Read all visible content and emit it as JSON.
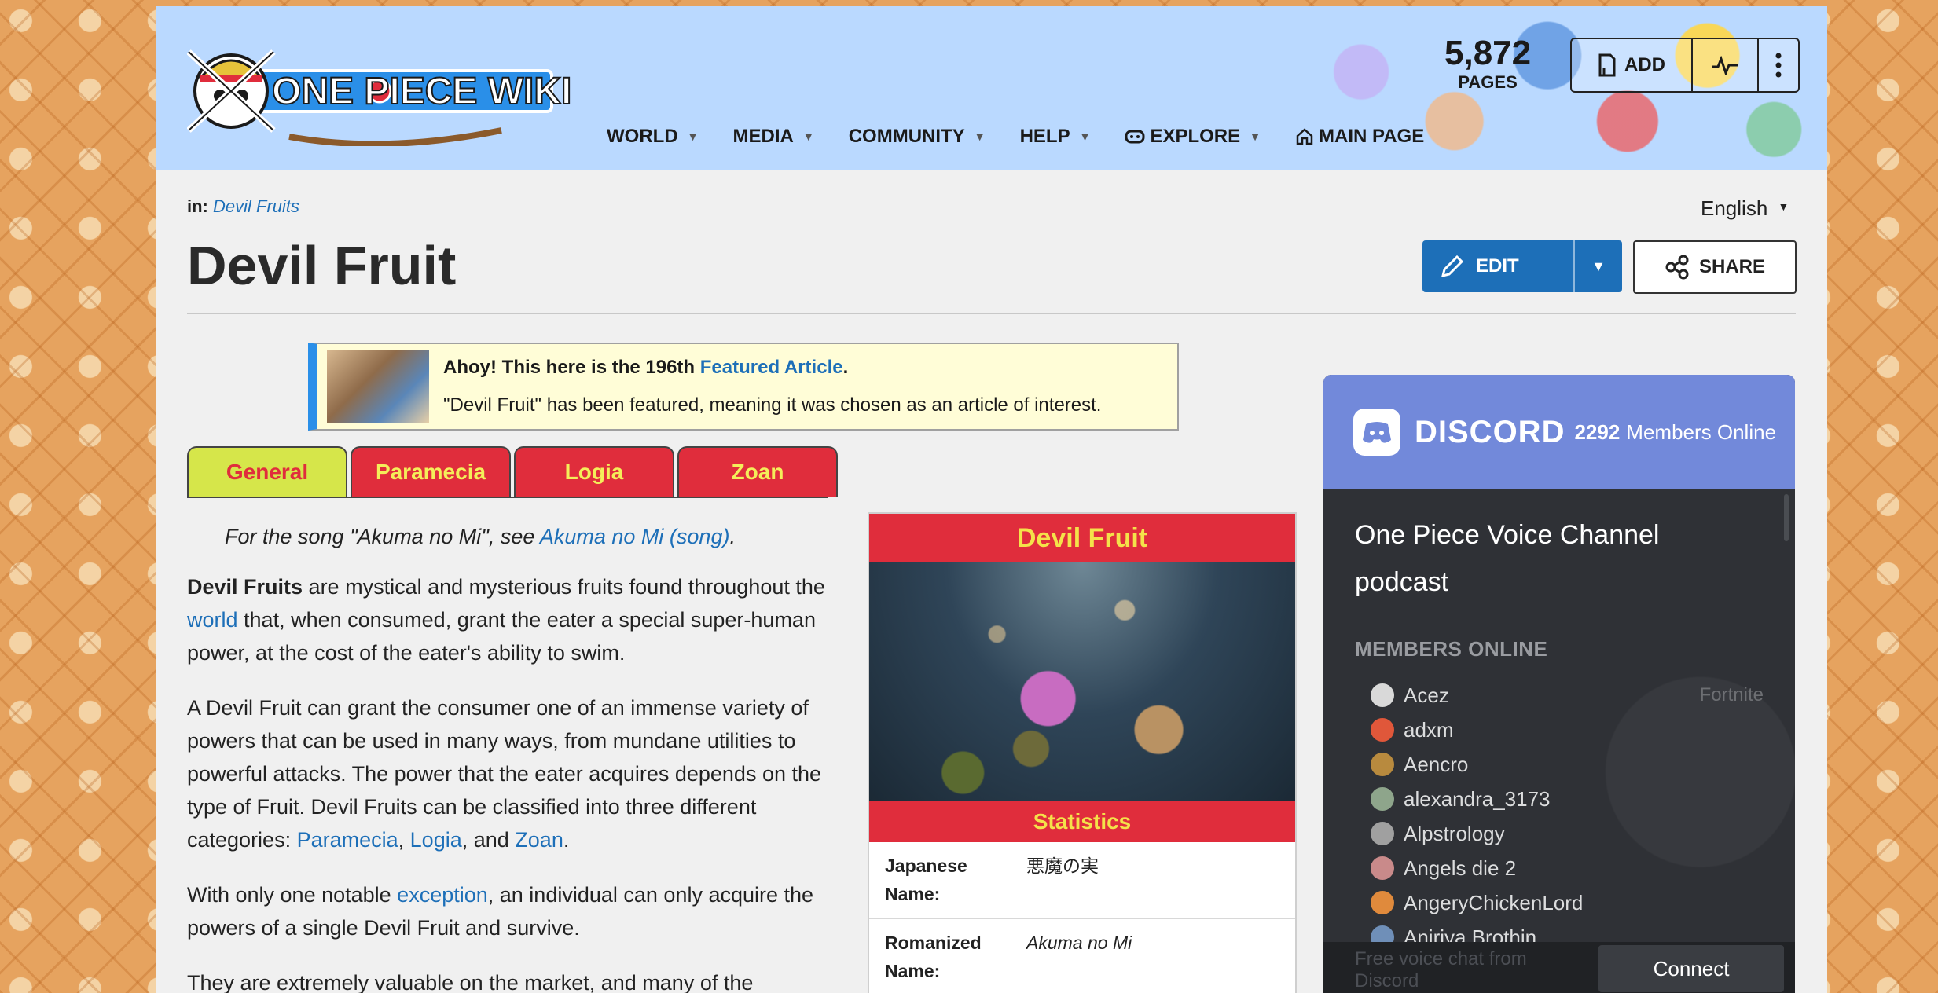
{
  "header": {
    "logo_text": "ONE PIECE WIKI",
    "page_count": "5,872",
    "page_count_label": "PAGES",
    "add_label": "ADD",
    "nav": [
      {
        "label": "WORLD"
      },
      {
        "label": "MEDIA"
      },
      {
        "label": "COMMUNITY"
      },
      {
        "label": "HELP"
      },
      {
        "label": "EXPLORE"
      },
      {
        "label": "MAIN PAGE"
      }
    ]
  },
  "breadcrumb": {
    "prefix": "in:",
    "link": "Devil Fruits"
  },
  "language": "English",
  "article": {
    "title": "Devil Fruit",
    "edit_label": "EDIT",
    "share_label": "SHARE"
  },
  "featured": {
    "line1_prefix": "Ahoy! This here is the 196th ",
    "line1_link": "Featured Article",
    "line1_suffix": ".",
    "line2": "\"Devil Fruit\" has been featured, meaning it was chosen as an article of interest."
  },
  "tabs": [
    {
      "label": "General",
      "active": true
    },
    {
      "label": "Paramecia",
      "active": false
    },
    {
      "label": "Logia",
      "active": false
    },
    {
      "label": "Zoan",
      "active": false
    }
  ],
  "content": {
    "hatnote_prefix": "For the song \"Akuma no Mi\", see ",
    "hatnote_link": "Akuma no Mi (song)",
    "hatnote_suffix": ".",
    "p1_bold": "Devil Fruits",
    "p1_a": " are mystical and mysterious fruits found throughout the ",
    "p1_link": "world",
    "p1_b": " that, when consumed, grant the eater a special super-human power, at the cost of the eater's ability to swim.",
    "p2_a": "A Devil Fruit can grant the consumer one of an immense variety of powers that can be used in many ways, from mundane utilities to powerful attacks. The power that the eater acquires depends on the type of Fruit. Devil Fruits can be classified into three different categories: ",
    "p2_link1": "Paramecia",
    "p2_sep1": ", ",
    "p2_link2": "Logia",
    "p2_sep2": ", and ",
    "p2_link3": "Zoan",
    "p2_end": ".",
    "p3_a": "With only one notable ",
    "p3_link": "exception",
    "p3_b": ", an individual can only acquire the powers of a single Devil Fruit and survive.",
    "p4": "They are extremely valuable on the market, and many of the"
  },
  "infobox": {
    "title": "Devil Fruit",
    "section": "Statistics",
    "rows": [
      {
        "key": "Japanese Name:",
        "value": "悪魔の実"
      },
      {
        "key": "Romanized Name:",
        "value": "Akuma no Mi"
      }
    ]
  },
  "discord": {
    "brand": "DISCORD",
    "count": "2292",
    "online_label": "Members Online",
    "channel": "One Piece Voice Channel podcast",
    "members_label": "MEMBERS ONLINE",
    "members": [
      {
        "name": "Acez",
        "game": "Fortnite",
        "color": "#d9d9d9"
      },
      {
        "name": "adxm",
        "game": "",
        "color": "#e0573a"
      },
      {
        "name": "Aencro",
        "game": "",
        "color": "#b88a3e"
      },
      {
        "name": "alexandra_3173",
        "game": "",
        "color": "#8ea58b"
      },
      {
        "name": "Alpstrology",
        "game": "",
        "color": "#a0a0a0"
      },
      {
        "name": "Angels die 2",
        "game": "",
        "color": "#c98a8a"
      },
      {
        "name": "AngeryChickenLord",
        "game": "",
        "color": "#e08a3c"
      },
      {
        "name": "Aniriya Brothin",
        "game": "",
        "color": "#6f8fb8"
      }
    ],
    "footer_text": "Free voice chat from Discord",
    "connect_label": "Connect"
  }
}
